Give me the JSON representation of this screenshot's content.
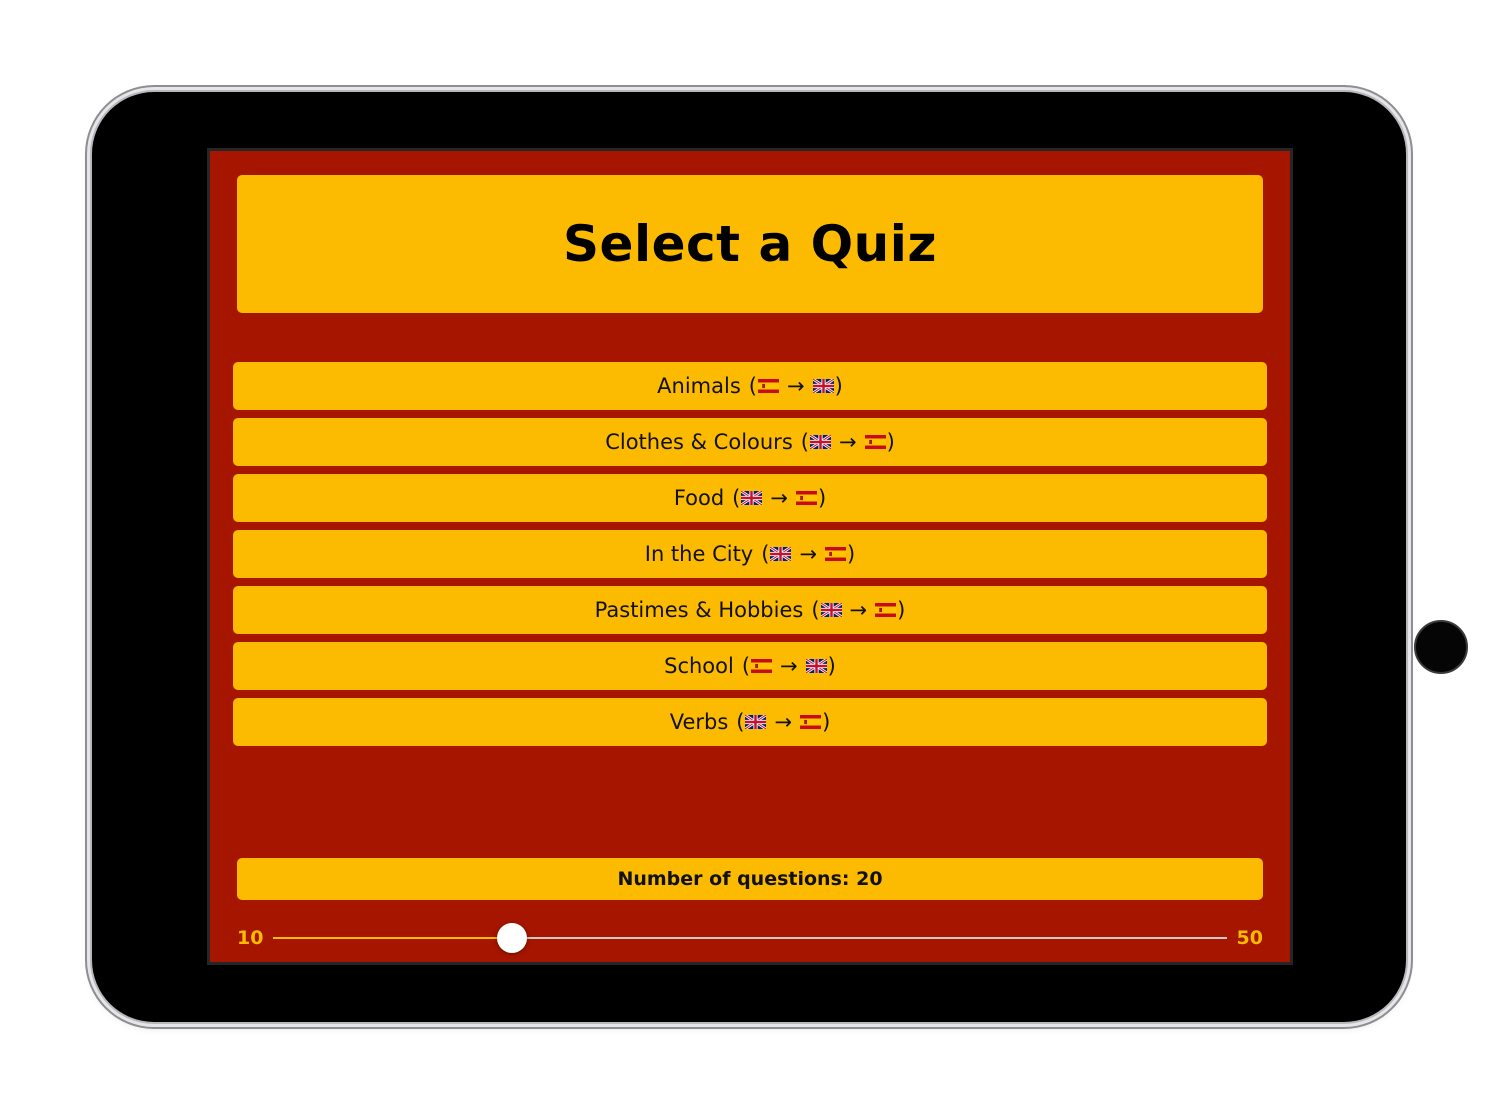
{
  "header": {
    "title": "Select a Quiz"
  },
  "quizzes": [
    {
      "name": "Animals",
      "from": "es",
      "to": "gb"
    },
    {
      "name": "Clothes & Colours",
      "from": "gb",
      "to": "es"
    },
    {
      "name": "Food",
      "from": "gb",
      "to": "es"
    },
    {
      "name": "In the City",
      "from": "gb",
      "to": "es"
    },
    {
      "name": "Pastimes & Hobbies",
      "from": "gb",
      "to": "es"
    },
    {
      "name": "School",
      "from": "es",
      "to": "gb"
    },
    {
      "name": "Verbs",
      "from": "gb",
      "to": "es"
    }
  ],
  "symbols": {
    "open_paren": "(",
    "close_paren": ")",
    "arrow": "→"
  },
  "question_count": {
    "label": "Number of questions: 20",
    "value": 20,
    "min": 10,
    "max": 50
  },
  "slider": {
    "min_label": "10",
    "max_label": "50"
  },
  "colors": {
    "background": "#a51500",
    "button": "#fcba00",
    "text": "#111111",
    "slider_track": "#c9c9c9",
    "slider_fill": "#fcba00",
    "slider_thumb": "#ffffff"
  },
  "icons": {
    "es": "spain-flag-icon",
    "gb": "uk-flag-icon"
  }
}
